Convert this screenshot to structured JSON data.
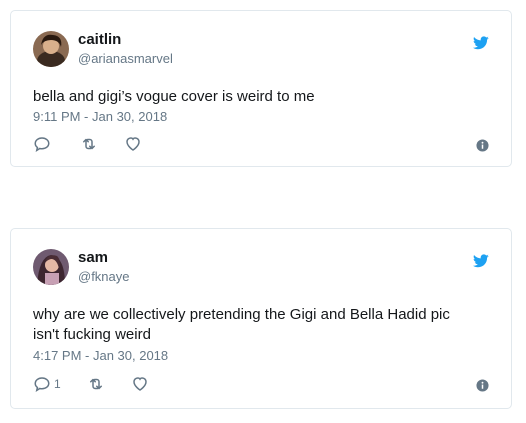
{
  "tweets": [
    {
      "name": "caitlin",
      "handle": "@arianasmarvel",
      "text": "bella and gigi’s vogue cover is weird to me",
      "time": "9:11 PM - Jan 30, 2018",
      "reply_count": "",
      "avatar_icon": "avatar-photo"
    },
    {
      "name": "sam",
      "handle": "@fknaye",
      "text": "why are we collectively pretending the Gigi and Bella Hadid pic\nisn't fucking weird",
      "time": "4:17 PM - Jan 30, 2018",
      "reply_count": "1",
      "avatar_icon": "avatar-photo"
    }
  ],
  "colors": {
    "brand_blue": "#1da1f2",
    "text_primary": "#14171a",
    "text_secondary": "#657786",
    "border": "#e1e8ed"
  },
  "icons": [
    "twitter-bird-icon",
    "reply-icon",
    "retweet-icon",
    "like-icon",
    "info-icon"
  ]
}
